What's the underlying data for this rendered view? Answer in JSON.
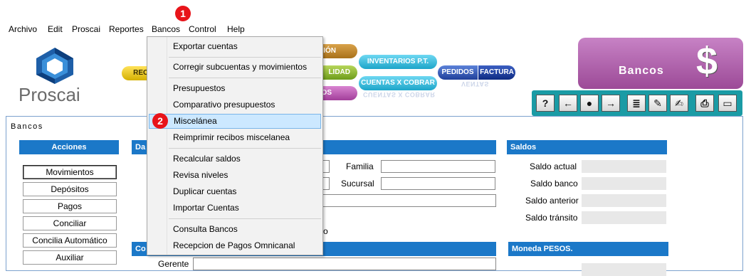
{
  "menubar": {
    "items": [
      "Archivo",
      "Edit",
      "Proscai",
      "Reportes",
      "Bancos",
      "Control",
      "Help"
    ]
  },
  "markers": [
    "1",
    "2"
  ],
  "logo": {
    "text": "Proscai"
  },
  "nav_pills": {
    "rece": "RECE",
    "cion": "CIÓN",
    "lidad": "LIDAD",
    "os": "OS",
    "inventarios": "INVENTARIOS P.T.",
    "cuentas_cobrar": "CUENTAS X COBRAR",
    "cuentas_cobrar_reflection": "CUENTAS X COBRAR",
    "pedidos": "PEDIDOS",
    "factura": "FACTURA",
    "ventas_reflection": "VENTAS"
  },
  "module_banner": {
    "title": "Bancos",
    "symbol": "$"
  },
  "toolbar": {
    "buttons": [
      "?",
      "←",
      "●",
      "→",
      "≣",
      "✎",
      "✍",
      "⎙",
      "▭"
    ],
    "icon_names": [
      "help-icon",
      "back-arrow-icon",
      "search-icon",
      "forward-arrow-icon",
      "list-icon",
      "edit-note-icon",
      "sign-icon",
      "print-icon",
      "window-icon"
    ]
  },
  "frame": {
    "title": "Bancos"
  },
  "acciones": {
    "header": "Acciones",
    "buttons": [
      "Movimientos",
      "Depósitos",
      "Pagos",
      "Conciliar",
      "Concilia Automático",
      "Auxiliar"
    ]
  },
  "datos": {
    "header_fragment": "Da",
    "familia_label": "Familia",
    "sucursal_label": "Sucursal",
    "trailing_o": "o"
  },
  "contacto": {
    "header_fragment": "Co",
    "gerente_label": "Gerente"
  },
  "saldos": {
    "header": "Saldos",
    "rows": [
      "Saldo actual",
      "Saldo banco",
      "Saldo anterior",
      "Saldo tránsito"
    ]
  },
  "moneda": {
    "header": "Moneda PESOS."
  },
  "dropdown": {
    "items": [
      "Exportar cuentas",
      "Corregir subcuentas y movimientos",
      "Presupuestos",
      "Comparativo presupuestos",
      "Miscelánea",
      "Reimprimir recibos miscelanea",
      "Recalcular saldos",
      "Revisa niveles",
      "Duplicar  cuentas",
      "Importar Cuentas",
      "Consulta Bancos",
      "Recepcion de Pagos Omnicanal"
    ],
    "highlighted_index": 4
  },
  "colors": {
    "section_header": "#1b78c8",
    "toolbar_bg": "#1a9ba5",
    "module_banner": "#b466b0",
    "highlight": "#cce8ff",
    "marker": "#e8141a"
  }
}
